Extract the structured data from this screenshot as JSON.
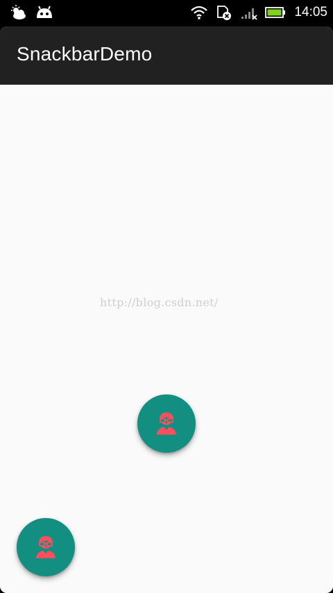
{
  "status_bar": {
    "time": "14:05",
    "icons": [
      "weather-icon",
      "android-icon",
      "wifi-icon",
      "sim-error-icon",
      "signal-icon",
      "battery-icon"
    ]
  },
  "app": {
    "title": "SnackbarDemo"
  },
  "content": {
    "watermark": "http://blog.csdn.net/"
  },
  "fabs": [
    {
      "name": "fab-center",
      "icon": "user-avatar-icon"
    },
    {
      "name": "fab-bottom-left",
      "icon": "user-avatar-icon"
    }
  ],
  "colors": {
    "toolbar": "#212121",
    "fab": "#128f80",
    "icon_accent": "#ff4f5e",
    "background": "#fafafa",
    "battery": "#7ed321"
  }
}
